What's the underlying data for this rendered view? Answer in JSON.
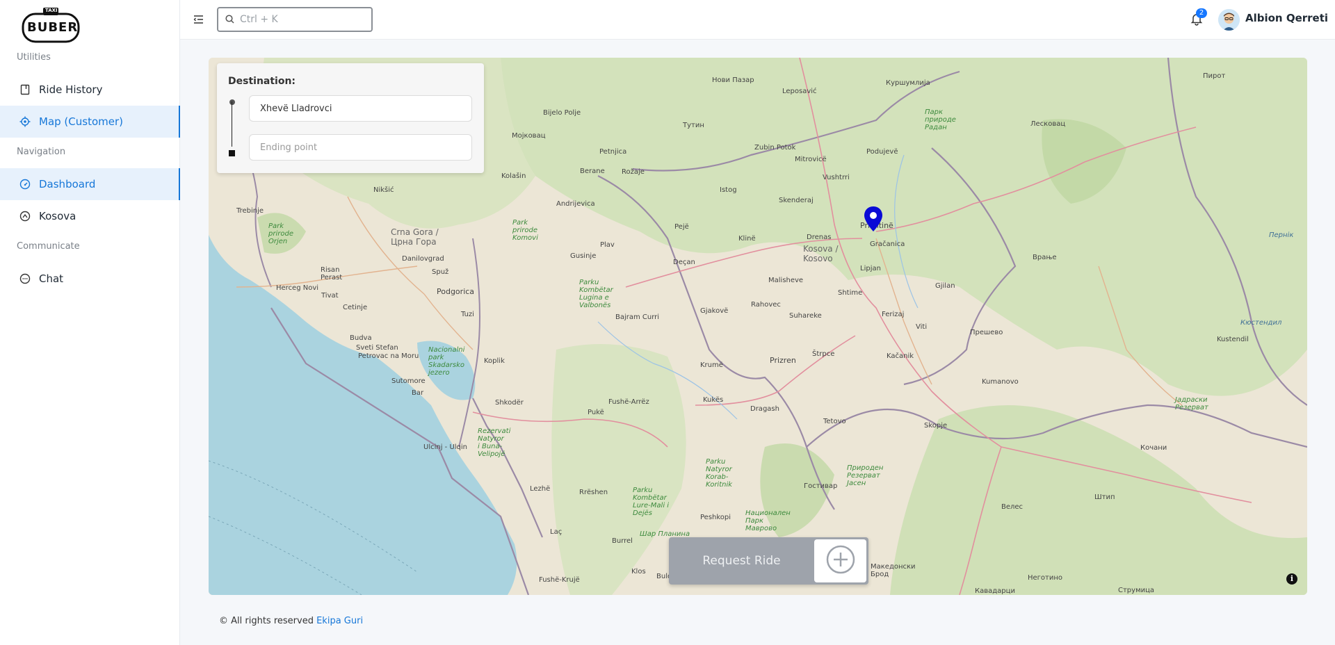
{
  "brand": {
    "logo_text": "BUBER",
    "logo_tag": "TAXI"
  },
  "sidebar": {
    "sections": [
      {
        "label": "Utilities"
      },
      {
        "label": "Navigation"
      },
      {
        "label": "Communicate"
      }
    ],
    "items": [
      {
        "label": "Ride History",
        "icon": "book-icon",
        "active": false
      },
      {
        "label": "Map (Customer)",
        "icon": "crosshair-icon",
        "active": true
      },
      {
        "label": "Dashboard",
        "icon": "dashboard-icon",
        "active": true
      },
      {
        "label": "Kosova",
        "icon": "compass-icon",
        "active": false
      },
      {
        "label": "Chat",
        "icon": "chat-icon",
        "active": false
      }
    ]
  },
  "header": {
    "search_placeholder": "Ctrl + K",
    "notifications_count": "2",
    "user_name": "Albion Qerreti"
  },
  "destination": {
    "title": "Destination:",
    "start_value": "Xhevë Lladrovci",
    "end_placeholder": "Ending point"
  },
  "request": {
    "label": "Request Ride"
  },
  "map": {
    "info_label": "i",
    "labels": [
      "Нови Пазар",
      "Leposavić",
      "Куршумлија",
      "Пирот",
      "Bijelo Polje",
      "Тутин",
      "Zubin Potok",
      "Podujevë",
      "Mitrovicë",
      "Лесковац",
      "Vushtrri",
      "Мојковац",
      "Petnjica",
      "Berane",
      "Rožaje",
      "Istog",
      "Skenderaj",
      "Prishtinë",
      "Gračanica",
      "Kolašin",
      "Nikšić",
      "Andrijevica",
      "Pejë",
      "Klinë",
      "Drenas",
      "Kosova / Kosovo",
      "Trebinje",
      "Crna Gora / Црна Гора",
      "Danilovgrad",
      "Plav",
      "Gusinje",
      "Deçan",
      "Malisheve",
      "Lipjan",
      "Gjilan",
      "Врање",
      "Risan",
      "Perast",
      "Spuž",
      "Herceg Novi",
      "Tivat",
      "Podgorica",
      "Rahovec",
      "Shtime",
      "Ferizaj",
      "Cetinje",
      "Gjakovë",
      "Suhareke",
      "Viti",
      "Прешево",
      "Budva",
      "Tuzi",
      "Bajram Curri",
      "Kustendil",
      "Sveti Stefan",
      "Petrovac na Moru",
      "Koplik",
      "Krumë",
      "Prizren",
      "Štrpce",
      "Kačanik",
      "Kumanovo",
      "Sutomore",
      "Bar",
      "Shkodër",
      "Fushë-Arrëz",
      "Kukës",
      "Dragash",
      "Tetovo",
      "Skopje",
      "Кочани",
      "Ulcinj - Ulqin",
      "Pukë",
      "Гостивар",
      "Велес",
      "Штип",
      "Lezhë",
      "Rrëshen",
      "Peshkopi",
      "Laç",
      "Burrel",
      "Klos",
      "Bulqizë",
      "Fushë-Krujë",
      "Македонски Брод",
      "Неготино",
      "Струмица",
      "Кавадарци"
    ],
    "park_labels": [
      "Park prirode Orjen",
      "Park prirode Komovi",
      "Parku Kombëtar Lugina e Valbonës",
      "Nacionalni park Skadarsko jezero",
      "Rezervati Natyror i Buna-Velipojë",
      "Parku Natyror Korab-Koritnik",
      "Parku Kombëtar Lure-Mali i Dejës",
      "Национален Парк Маврово",
      "Природен Резерват Јасен",
      "Парк природе Радан",
      "Јадраски Резерват",
      "Пернік",
      "Кюстендил",
      "Шар Планина"
    ]
  },
  "footer": {
    "text": "© All rights reserved",
    "link": "Ekipa Guri"
  }
}
